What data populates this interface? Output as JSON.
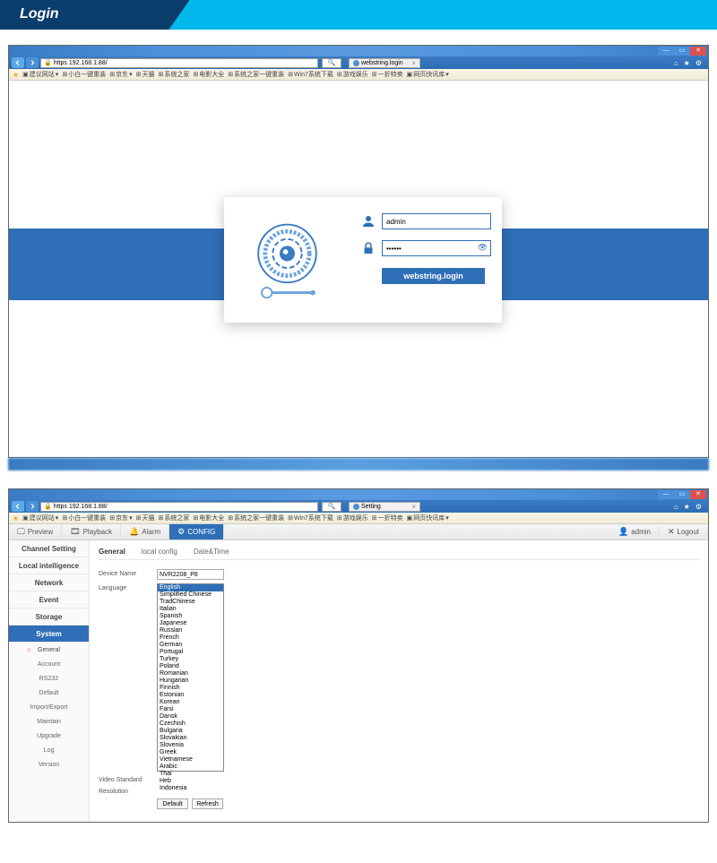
{
  "banner": {
    "title": "Login"
  },
  "browser1": {
    "url": "https 192.168.1.88/",
    "search_icon": "🔍",
    "tab_label": "webstring.login",
    "favbar": [
      "建议网站",
      "小白一键重装",
      "京东",
      "天猫",
      "系统之家",
      "电影大全",
      "系统之家一键重装",
      "Win7系统下载",
      "游戏娱乐",
      "一折特卖",
      "网页快讯库"
    ]
  },
  "login": {
    "username": "admin",
    "password": "••••••",
    "button": "webstring.login"
  },
  "browser2": {
    "url": "https 192.168.1.88/",
    "tab_label": "Setting",
    "favbar": [
      "建议网站",
      "小白一键重装",
      "京东",
      "天猫",
      "系统之家",
      "电影大全",
      "系统之家一键重装",
      "Win7系统下载",
      "游戏娱乐",
      "一折特卖",
      "网页快讯库"
    ]
  },
  "apptoolbar": {
    "preview": "Preview",
    "playback": "Playback",
    "alarm": "Alarm",
    "config": "CONFIG",
    "admin": "admin",
    "logout": "Logout"
  },
  "sidebar": {
    "items": [
      "Channel Setting",
      "Local intelligence",
      "Network",
      "Event",
      "Storage",
      "System"
    ],
    "subs": [
      "General",
      "Account",
      "RS232",
      "Default",
      "Import/Export",
      "Maintain",
      "Upgrade",
      "Log",
      "Version"
    ]
  },
  "tabs": {
    "general": "General",
    "local": "local config",
    "datetime": "Date&Time"
  },
  "form": {
    "devicename_label": "Device Name",
    "devicename_value": "NVR2208_P8",
    "language_label": "Language",
    "videostd_label": "Video Standard",
    "resolution_label": "Resolution",
    "default_btn": "Default",
    "refresh_btn": "Refresh"
  },
  "languages": [
    "English",
    "Simplified Chinese",
    "TradChinese",
    "Italian",
    "Spanish",
    "Japanese",
    "Russian",
    "French",
    "German",
    "Portugal",
    "Turkey",
    "Poland",
    "Romanian",
    "Hungarian",
    "Finnish",
    "Estonian",
    "Korean",
    "Farsi",
    "Dansk",
    "Czechish",
    "Bulgaria",
    "Slovakian",
    "Slovenia",
    "Greek",
    "Vietnamese",
    "Arabic",
    "Thai",
    "Heb",
    "Indonesia"
  ]
}
